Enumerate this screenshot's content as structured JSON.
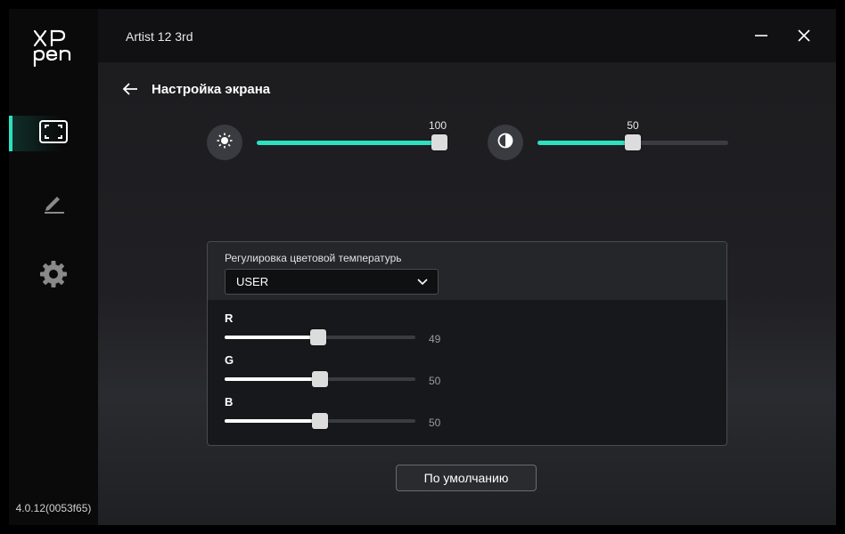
{
  "app": {
    "title": "Artist 12 3rd",
    "version": "4.0.12(0053f65)"
  },
  "sidebar": {
    "items": [
      {
        "name": "display",
        "icon": "display-fullscreen-icon",
        "active": true
      },
      {
        "name": "pen",
        "icon": "pen-icon",
        "active": false
      },
      {
        "name": "settings",
        "icon": "gear-icon",
        "active": false
      }
    ]
  },
  "page": {
    "title": "Настройка экрана"
  },
  "brightness": {
    "icon": "sun-icon",
    "value": "100",
    "level": 100
  },
  "contrast": {
    "icon": "contrast-icon",
    "value": "50",
    "level": 50
  },
  "color_temp": {
    "label": "Регулировка цветовой температурь",
    "selected": "USER",
    "channels": [
      {
        "label": "R",
        "value": "49",
        "level": 49
      },
      {
        "label": "G",
        "value": "50",
        "level": 50
      },
      {
        "label": "B",
        "value": "50",
        "level": 50
      }
    ]
  },
  "reset_button": {
    "label": "По умолчанию"
  },
  "colors": {
    "accent": "#2de0c0",
    "background": "#1c1c1f",
    "sidebar": "#0a0a0a"
  }
}
